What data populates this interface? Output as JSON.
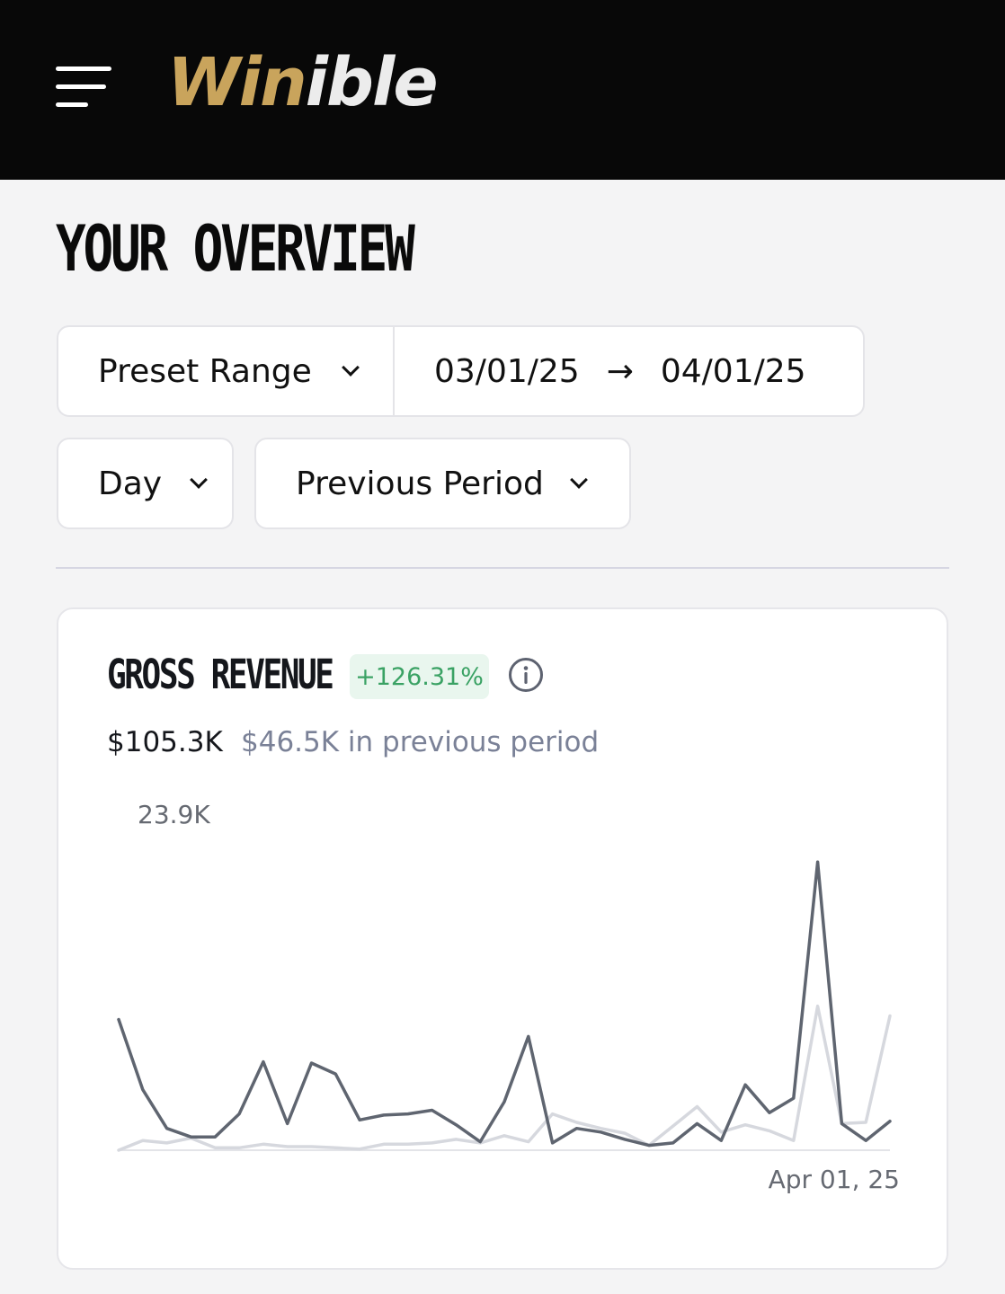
{
  "header": {
    "logo_part1": "Win",
    "logo_part2": "ible",
    "colors": {
      "gold": "#c9a45c",
      "logo_white": "#ececec",
      "bar": "#080808"
    }
  },
  "page": {
    "title": "YOUR OVERVIEW"
  },
  "filters": {
    "preset_label": "Preset Range",
    "start_date": "03/01/25",
    "arrow": "→",
    "end_date": "04/01/25",
    "granularity": "Day",
    "compare": "Previous Period"
  },
  "revenue_card": {
    "title": "GROSS REVENUE",
    "change_badge": "+126.31%",
    "total": "$105.3K",
    "previous_text": "$46.5K in previous period",
    "info_icon": "info-icon",
    "colors": {
      "badge_bg": "#e9f6ee",
      "badge_text": "#3aa264",
      "current_line": "#5f6570",
      "previous_line": "#d6d8de"
    }
  },
  "chart_data": {
    "type": "line",
    "ymax_label": "23.9K",
    "ylim": [
      0,
      23.9
    ],
    "x_end_label": "Apr 01, 25",
    "series": [
      {
        "values": [
          10.8,
          5.0,
          1.8,
          1.1,
          1.1,
          3.0,
          7.3,
          2.2,
          7.2,
          6.3,
          2.5,
          2.9,
          3.0,
          3.3,
          2.1,
          0.7,
          4.0,
          9.4,
          0.6,
          1.8,
          1.5,
          0.9,
          0.4,
          0.6,
          2.2,
          0.8,
          5.4,
          3.1,
          4.3,
          23.8,
          2.2,
          0.8,
          2.4
        ]
      },
      {
        "values": [
          0.0,
          0.8,
          0.6,
          1.0,
          0.2,
          0.2,
          0.5,
          0.3,
          0.3,
          0.2,
          0.1,
          0.5,
          0.5,
          0.6,
          0.9,
          0.6,
          1.2,
          0.7,
          3.0,
          2.3,
          1.8,
          1.4,
          0.4,
          2.0,
          3.6,
          1.5,
          2.1,
          1.6,
          0.8,
          11.9,
          2.2,
          2.3,
          11.1
        ]
      }
    ]
  }
}
